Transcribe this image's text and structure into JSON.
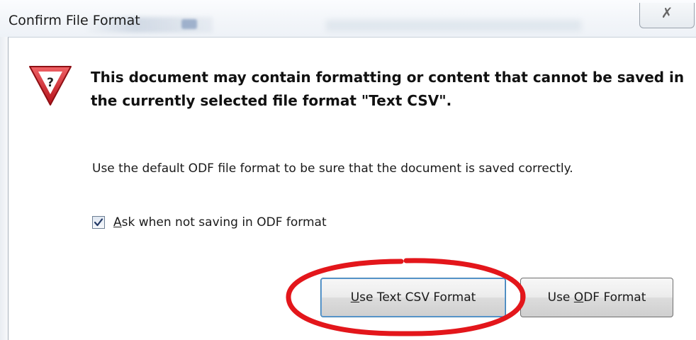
{
  "window": {
    "title": "Confirm File Format",
    "close_glyph": "✗"
  },
  "dialog": {
    "icon": "warning-question-icon",
    "heading": "This document may contain formatting or content that cannot be saved in the currently selected file format \"Text CSV\".",
    "info": "Use the default ODF file format to be sure that the document is saved correctly.",
    "checkbox": {
      "checked": true,
      "label_underlined": "A",
      "label_rest": "sk when not saving in ODF format"
    },
    "buttons": {
      "csv_underlined": "U",
      "csv_rest": "se Text CSV Format",
      "odf_prefix": "Use ",
      "odf_underlined": "O",
      "odf_rest": "DF Format"
    }
  },
  "colors": {
    "warning_red": "#d9262b",
    "annotation_red": "#e3161b",
    "focus_blue": "#3c7fb1"
  }
}
